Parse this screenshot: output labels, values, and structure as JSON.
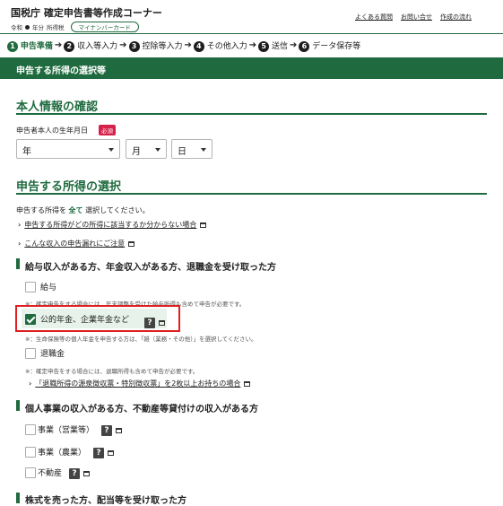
{
  "header": {
    "title": "国税庁 確定申告書等作成コーナー",
    "era_prefix": "令和",
    "year_text": "年分",
    "tax_type": "所得税",
    "mynumber_badge": "マイナンバーカード",
    "links": [
      "よくある質問",
      "お問い合せ",
      "作成の流れ"
    ]
  },
  "steps": [
    {
      "num": "1",
      "label": "申告準備"
    },
    {
      "num": "2",
      "label": "収入等入力"
    },
    {
      "num": "3",
      "label": "控除等入力"
    },
    {
      "num": "4",
      "label": "その他入力"
    },
    {
      "num": "5",
      "label": "送信"
    },
    {
      "num": "6",
      "label": "データ保存等"
    }
  ],
  "banner": {
    "title": "申告する所得の選択等"
  },
  "personal": {
    "heading": "本人情報の確認",
    "birth_label": "申告者本人の生年月日",
    "required_badge": "必須",
    "year_placeholder": "年",
    "month_placeholder": "月",
    "day_placeholder": "日"
  },
  "income_select": {
    "heading": "申告する所得の選択",
    "instruction_pre": "申告する所得を",
    "instruction_bold": "全て",
    "instruction_post": "選択してください。",
    "link1": "申告する所得がどの所得に該当するか分からない場合",
    "link2": "こんな収入の申告漏れにご注意"
  },
  "group1": {
    "heading": "給与収入がある方、年金収入がある方、退職金を受け取った方",
    "salary_label": "給与",
    "salary_note": "※：確定申告をする場合には、年末調整を受けた給与所得も含めて申告が必要です。",
    "pension_label": "公的年金、企業年金など",
    "pension_checked": true,
    "pension_note": "※：生命保険等の個人年金を申告する方は、「雑（業務・その他）」を選択してください。",
    "retire_label": "退職金",
    "retire_note": "※：確定申告をする場合には、退職所得も含めて申告が必要です。",
    "retire_link": "「退職所得の源泉徴収票・特別徴収票」を2枚以上お持ちの場合"
  },
  "group2": {
    "heading": "個人事業の収入がある方、不動産等貸付けの収入がある方",
    "items": [
      "事業（営業等）",
      "事業（農業）",
      "不動産"
    ]
  },
  "group3": {
    "heading": "株式を売った方、配当等を受け取った方"
  },
  "colors": {
    "accent": "#1f6b3f",
    "required": "#d6224a",
    "highlight": "#e02020"
  }
}
